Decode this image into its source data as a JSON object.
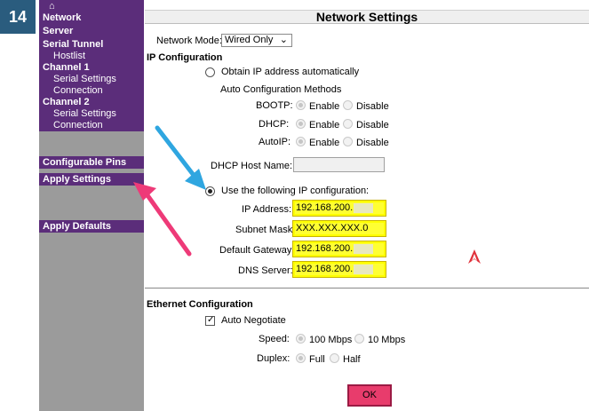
{
  "step_number": "14",
  "sidebar": {
    "home_icon": "home-icon",
    "items": [
      {
        "label": "Network",
        "kind": "head"
      },
      {
        "label": "Server",
        "kind": "head"
      },
      {
        "label": "Serial Tunnel",
        "kind": "head"
      },
      {
        "label": "Hostlist",
        "kind": "sub"
      },
      {
        "label": "Channel 1",
        "kind": "head"
      },
      {
        "label": "Serial Settings",
        "kind": "sub"
      },
      {
        "label": "Connection",
        "kind": "sub"
      },
      {
        "label": "Channel 2",
        "kind": "head"
      },
      {
        "label": "Serial Settings",
        "kind": "sub"
      },
      {
        "label": "Connection",
        "kind": "sub"
      }
    ],
    "configurable_pins": "Configurable Pins",
    "apply_settings": "Apply Settings",
    "apply_defaults": "Apply Defaults"
  },
  "page_title": "Network Settings",
  "network_mode": {
    "label": "Network Mode:",
    "value": "Wired Only"
  },
  "ip_config": {
    "heading": "IP Configuration",
    "obtain_auto": "Obtain IP address automatically",
    "auto_methods": "Auto Configuration Methods",
    "bootp_label": "BOOTP:",
    "dhcp_label": "DHCP:",
    "autoip_label": "AutoIP:",
    "enable": "Enable",
    "disable": "Disable",
    "dhcp_host_label": "DHCP Host Name:",
    "use_following": "Use the following IP configuration:",
    "ip_address_label": "IP Address:",
    "ip_address_value": "192.168.200.",
    "subnet_mask_label": "Subnet Mask:",
    "subnet_mask_value": "XXX.XXX.XXX.0",
    "gateway_label": "Default Gateway:",
    "gateway_value": "192.168.200.",
    "dns_label": "DNS Server:",
    "dns_value": "192.168.200."
  },
  "ethernet": {
    "heading": "Ethernet Configuration",
    "auto_negotiate": "Auto Negotiate",
    "speed_label": "Speed:",
    "speed_100": "100 Mbps",
    "speed_10": "10 Mbps",
    "duplex_label": "Duplex:",
    "full": "Full",
    "half": "Half"
  },
  "ok_label": "OK",
  "colors": {
    "sidebar_purple": "#5b2d7a",
    "sidebar_gray": "#9b9b9b",
    "highlight_yellow": "#ffff00",
    "ok_pink": "#e83c6c",
    "arrow_blue": "#2fa6e0",
    "arrow_pink": "#ee3a78"
  }
}
